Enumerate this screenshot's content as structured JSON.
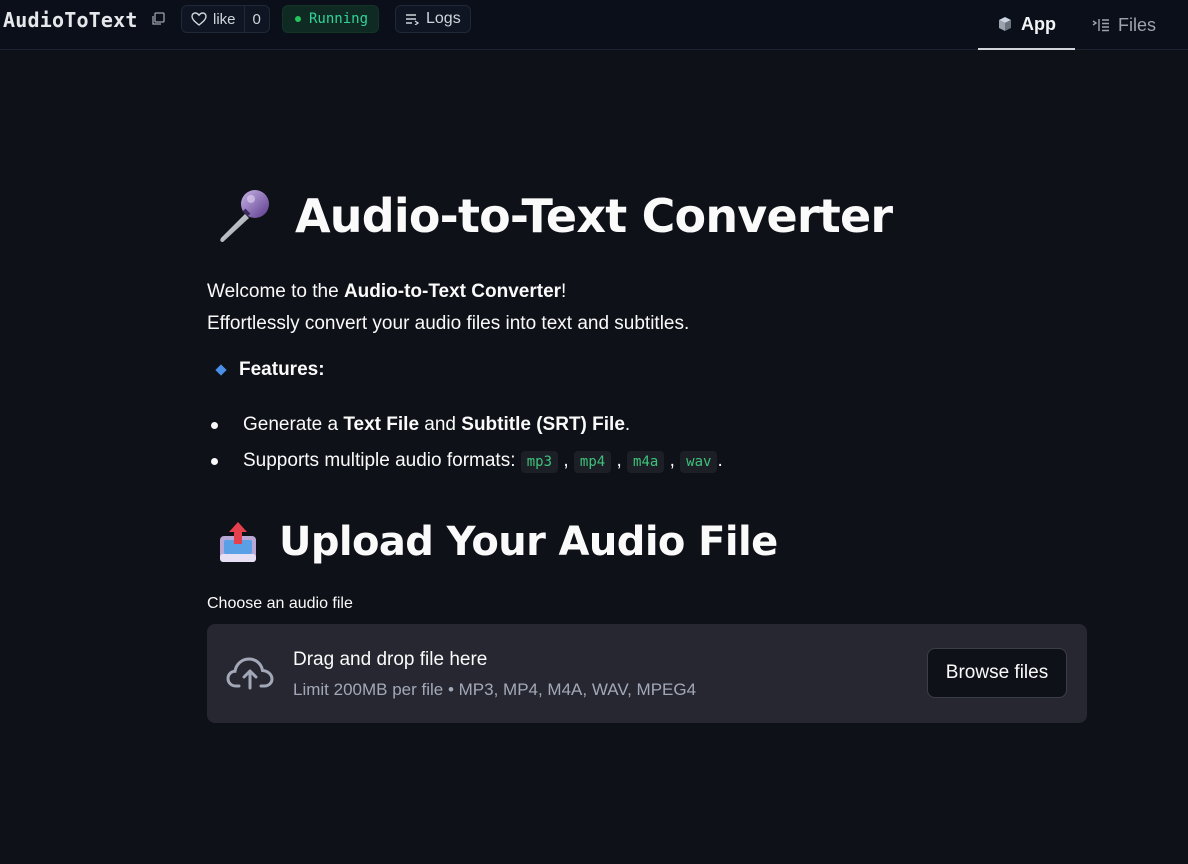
{
  "header": {
    "app_name": "AudioToText",
    "like_label": "like",
    "like_count": "0",
    "status": "Running",
    "logs_label": "Logs",
    "tabs": [
      {
        "label": "App",
        "active": true
      },
      {
        "label": "Files",
        "active": false
      }
    ]
  },
  "main": {
    "title": "Audio-to-Text Converter",
    "welcome_prefix": "Welcome to the ",
    "welcome_bold": "Audio-to-Text Converter",
    "welcome_suffix": "!",
    "tagline": "Effortlessly convert your audio files into text and subtitles.",
    "features_label": "Features:",
    "bullet1": {
      "prefix": "Generate a ",
      "bold1": "Text File",
      "middle": " and ",
      "bold2": "Subtitle (SRT) File",
      "suffix": "."
    },
    "bullet2": {
      "prefix": "Supports multiple audio formats: ",
      "formats": [
        "mp3",
        "mp4",
        "m4a",
        "wav"
      ],
      "sep": ",",
      "suffix": "."
    },
    "upload_title": "Upload Your Audio File",
    "choose_label": "Choose an audio file",
    "dropzone": {
      "title": "Drag and drop file here",
      "subtitle": "Limit 200MB per file • MP3, MP4, M4A, WAV, MPEG4",
      "button": "Browse files"
    }
  },
  "colors": {
    "background": "#0e1117",
    "header_bg": "#0b0f19",
    "status_green": "#34d399",
    "code_green": "#3ec27a",
    "dropzone_bg": "#262730"
  }
}
